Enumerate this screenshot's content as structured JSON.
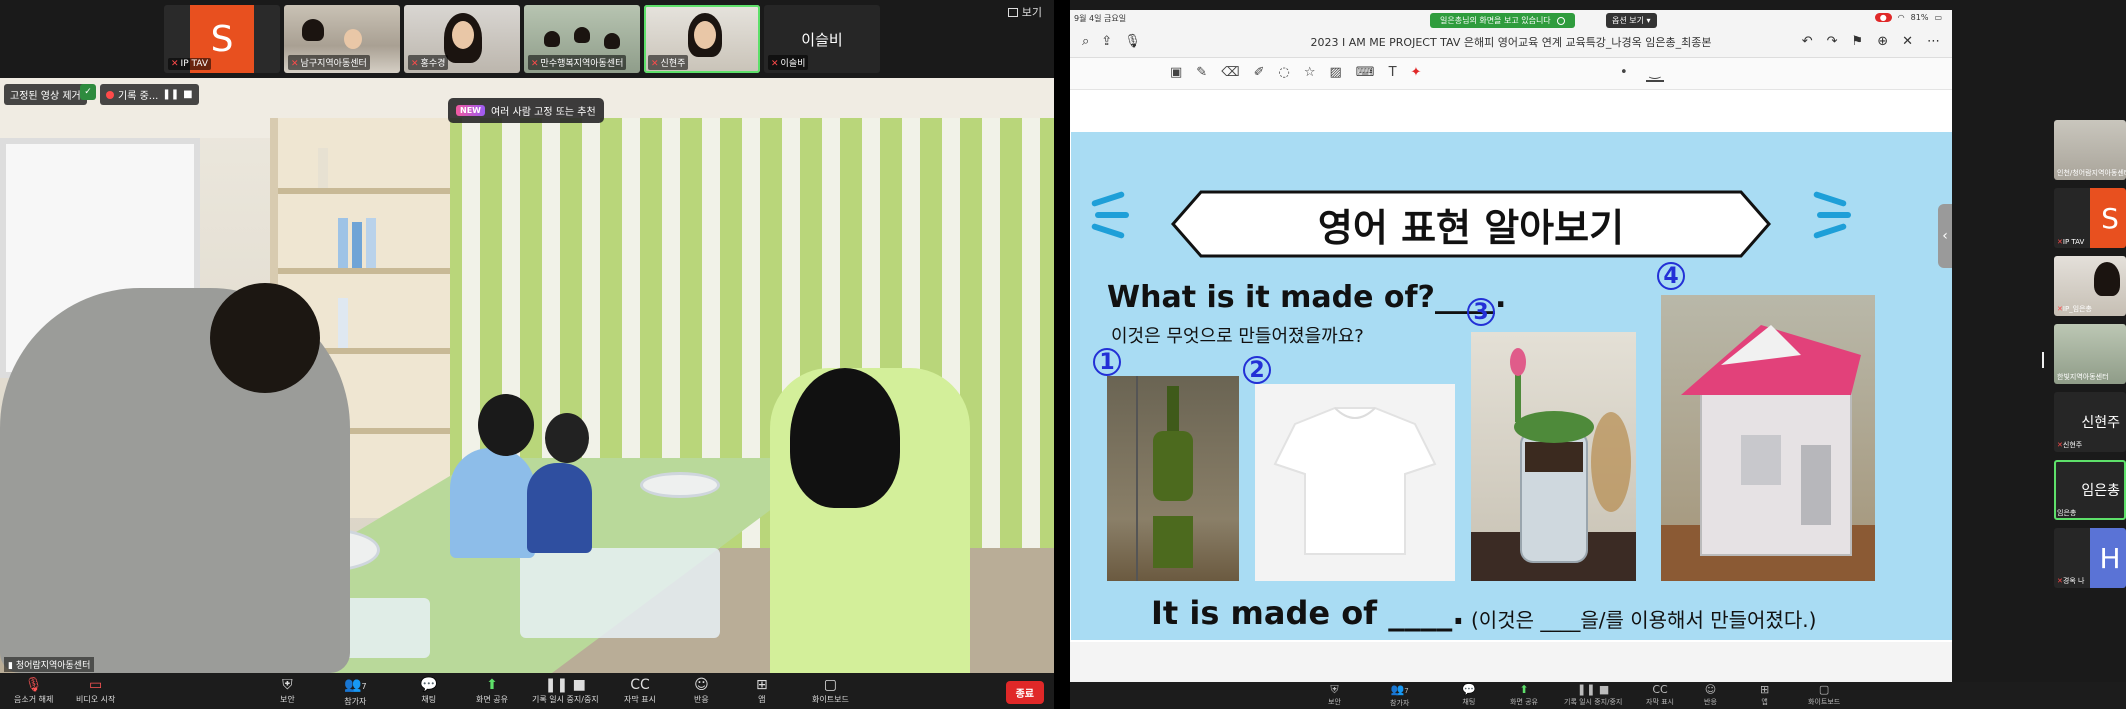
{
  "left": {
    "view_label": "보기",
    "thumbnails": [
      {
        "name": "IP TAV",
        "avatar_letter": "S",
        "kind": "avatar"
      },
      {
        "name": "남구지역아동센터",
        "kind": "video"
      },
      {
        "name": "홍수경",
        "kind": "video"
      },
      {
        "name": "만수행복지역아동센터",
        "kind": "video"
      },
      {
        "name": "신현주",
        "kind": "video",
        "active": true
      },
      {
        "name": "이슬비",
        "kind": "name-only",
        "display_name": "이슬비"
      }
    ],
    "pinned_label": "고정된 영상 제거",
    "recording_label": "기록 중...",
    "new_toast": {
      "badge": "NEW",
      "text": "여러 사람 고정 또는 추천"
    },
    "speaker_label": "청어람지역아동센터",
    "toolbar": [
      {
        "icon": "mic-muted",
        "label": "음소거 해제"
      },
      {
        "icon": "video-off",
        "label": "비디오 시작"
      },
      {
        "icon": "shield",
        "label": "보안"
      },
      {
        "icon": "participants",
        "label": "참가자",
        "count": "7"
      },
      {
        "icon": "chat",
        "label": "채팅"
      },
      {
        "icon": "share",
        "label": "화면 공유"
      },
      {
        "icon": "record-pause",
        "label": "기록 일시 중지/중지"
      },
      {
        "icon": "captions",
        "label": "자막 표시"
      },
      {
        "icon": "reactions",
        "label": "반응"
      },
      {
        "icon": "apps",
        "label": "앱"
      },
      {
        "icon": "whiteboard",
        "label": "화이트보드"
      }
    ],
    "end_label": "종료"
  },
  "right": {
    "share_banner": "일은총님의 화면을 보고 있습니다",
    "options_label": "옵션 보기",
    "ipad": {
      "date": "9월 4일 금요일",
      "battery": "81%",
      "title": "2023 I AM ME PROJECT TAV 은해피 영어교육 연계 교육특강_나경옥 임은총_최종본"
    },
    "slide": {
      "title": "영어 표현 알아보기",
      "question_en": "What is it made of?____.",
      "question_ko": "이것은 무엇으로 만들어졌을까요?",
      "numbers": [
        "1",
        "2",
        "3",
        "4"
      ],
      "answer_en": "It is made of ____.",
      "answer_ko": "(이것은 ____을/를 이용해서 만들어졌다.)"
    },
    "gallery": [
      {
        "name": "인천/청어람지역아동센터"
      },
      {
        "name": "IP TAV",
        "avatar_letter": "S"
      },
      {
        "name": "IP_임은총"
      },
      {
        "name": "한빛지역아동센터"
      },
      {
        "name": "신현주",
        "display_name": "신현주"
      },
      {
        "name": "임은총",
        "display_name": "임은총",
        "active": true
      },
      {
        "name": "경옥 나",
        "avatar_letter": "H"
      }
    ],
    "toolbar": [
      {
        "label": "보안"
      },
      {
        "label": "참가자",
        "count": "7"
      },
      {
        "label": "채팅"
      },
      {
        "label": "화면 공유"
      },
      {
        "label": "기록 일시 중지/중지"
      },
      {
        "label": "자막 표시"
      },
      {
        "label": "반응"
      },
      {
        "label": "앱"
      },
      {
        "label": "화이트보드"
      }
    ]
  }
}
